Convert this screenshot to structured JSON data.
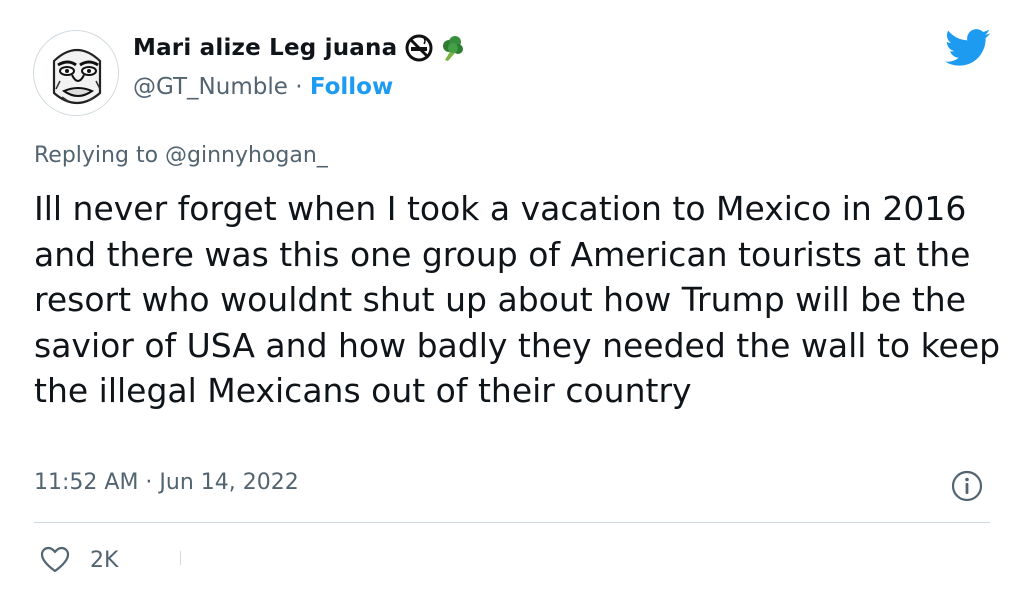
{
  "tweet": {
    "author": {
      "display_name": "Mari alize Leg juana",
      "handle": "@GT_Numble",
      "separator": " · ",
      "follow_label": "Follow",
      "name_emojis": [
        "no-smoking-icon",
        "broccoli-icon"
      ]
    },
    "replying_to": {
      "prefix": "Replying to ",
      "mention": "@ginnyhogan_"
    },
    "text": "Ill never forget when I took a vacation to Mexico in 2016 and there was this one group of American tourists at the resort who wouldnt shut up about how Trump will be the savior of USA and how badly they needed the wall to keep the illegal Mexicans out of their country",
    "timestamp": "11:52 AM · Jun 14, 2022",
    "likes": "2K"
  },
  "colors": {
    "text": "#0f1419",
    "secondary": "#536471",
    "accent": "#1d9bf0",
    "divider": "#cfd9de"
  },
  "icons": {
    "logo": "twitter-bird-icon",
    "info": "info-icon",
    "like": "heart-icon"
  }
}
